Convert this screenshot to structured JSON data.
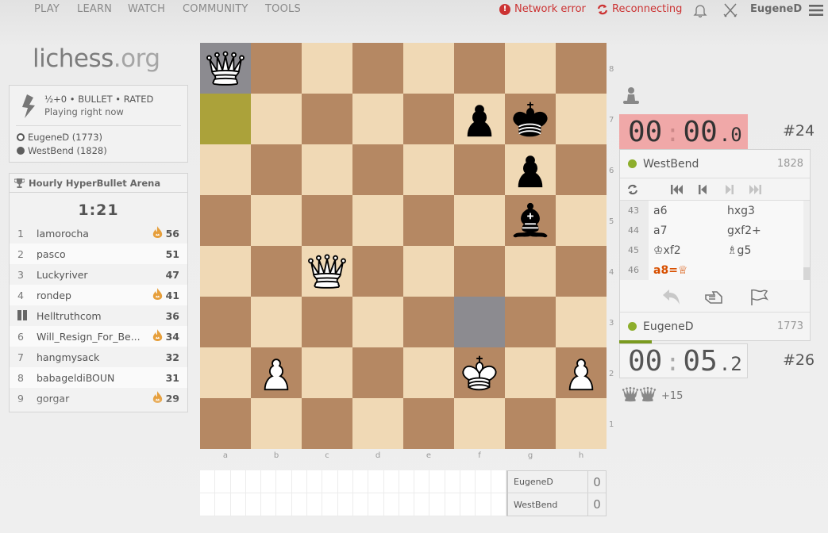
{
  "nav": {
    "items": [
      "PLAY",
      "LEARN",
      "WATCH",
      "COMMUNITY",
      "TOOLS"
    ],
    "network_error": "Network error",
    "reconnecting": "Reconnecting",
    "username": "EugeneD",
    "icons": [
      "bell-icon",
      "swords-icon",
      "hamburger-menu-icon"
    ]
  },
  "logo": {
    "name": "lichess",
    "tld": ".org"
  },
  "game_info": {
    "line1": "½+0 • BULLET • RATED",
    "line2": "Playing right now",
    "white_player": "EugeneD (1773)",
    "black_player": "WestBend (1828)"
  },
  "tournament": {
    "title": "Hourly HyperBullet Arena",
    "clock": "1:21",
    "standings": [
      {
        "rank": "1",
        "name": "lamorocha",
        "fire": true,
        "score": "56",
        "paused": false
      },
      {
        "rank": "2",
        "name": "pasco",
        "fire": false,
        "score": "51",
        "paused": false
      },
      {
        "rank": "3",
        "name": "Luckyriver",
        "fire": false,
        "score": "47",
        "paused": false
      },
      {
        "rank": "4",
        "name": "rondep",
        "fire": true,
        "score": "41",
        "paused": false
      },
      {
        "rank": "",
        "name": "Helltruthcom",
        "fire": false,
        "score": "36",
        "paused": true
      },
      {
        "rank": "6",
        "name": "Will_Resign_For_Be...",
        "fire": true,
        "score": "34",
        "paused": false
      },
      {
        "rank": "7",
        "name": "hangmysack",
        "fire": false,
        "score": "32",
        "paused": false
      },
      {
        "rank": "8",
        "name": "babageldiBOUN",
        "fire": false,
        "score": "31",
        "paused": false
      },
      {
        "rank": "9",
        "name": "gorgar",
        "fire": true,
        "score": "29",
        "paused": false
      }
    ]
  },
  "board": {
    "files": [
      "a",
      "b",
      "c",
      "d",
      "e",
      "f",
      "g",
      "h"
    ],
    "ranks": [
      "8",
      "7",
      "6",
      "5",
      "4",
      "3",
      "2",
      "1"
    ],
    "pieces": [
      {
        "square": "a8",
        "piece": "wQ"
      },
      {
        "square": "f7",
        "piece": "bP"
      },
      {
        "square": "g7",
        "piece": "bK"
      },
      {
        "square": "g6",
        "piece": "bP"
      },
      {
        "square": "g5",
        "piece": "bB"
      },
      {
        "square": "c4",
        "piece": "wQ"
      },
      {
        "square": "b2",
        "piece": "wP"
      },
      {
        "square": "f2",
        "piece": "wK"
      },
      {
        "square": "h2",
        "piece": "wP"
      }
    ],
    "last_move": [
      "a7",
      "a8"
    ],
    "highlight_grey": [
      "a8",
      "f3"
    ]
  },
  "crosstable": {
    "players": [
      {
        "name": "EugeneD",
        "score": "0"
      },
      {
        "name": "WestBend",
        "score": "0"
      }
    ]
  },
  "opponent": {
    "name": "WestBend",
    "rating": "1828",
    "clock_min": "00",
    "clock_sec": "00",
    "clock_tenth": "0",
    "rank": "#24"
  },
  "me": {
    "name": "EugeneD",
    "rating": "1773",
    "clock_min": "00",
    "clock_sec": "05",
    "clock_tenth": "2",
    "rank": "#26",
    "material": "+15"
  },
  "moves": [
    {
      "num": "43",
      "white": "a6",
      "black": "hxg3"
    },
    {
      "num": "44",
      "white": "a7",
      "black": "gxf2+"
    },
    {
      "num": "45",
      "white": "♔xf2",
      "black": "♗g5"
    },
    {
      "num": "46",
      "white": "a8=♕",
      "black": ""
    }
  ],
  "active_move": "46w",
  "colors": {
    "light_square": "#f0d9b5",
    "dark_square": "#b58863",
    "last_move": "#aba23a",
    "error": "#cc3333",
    "online": "#8dae2c",
    "active_move": "#d85000",
    "low_clock": "#f0a8a8"
  }
}
